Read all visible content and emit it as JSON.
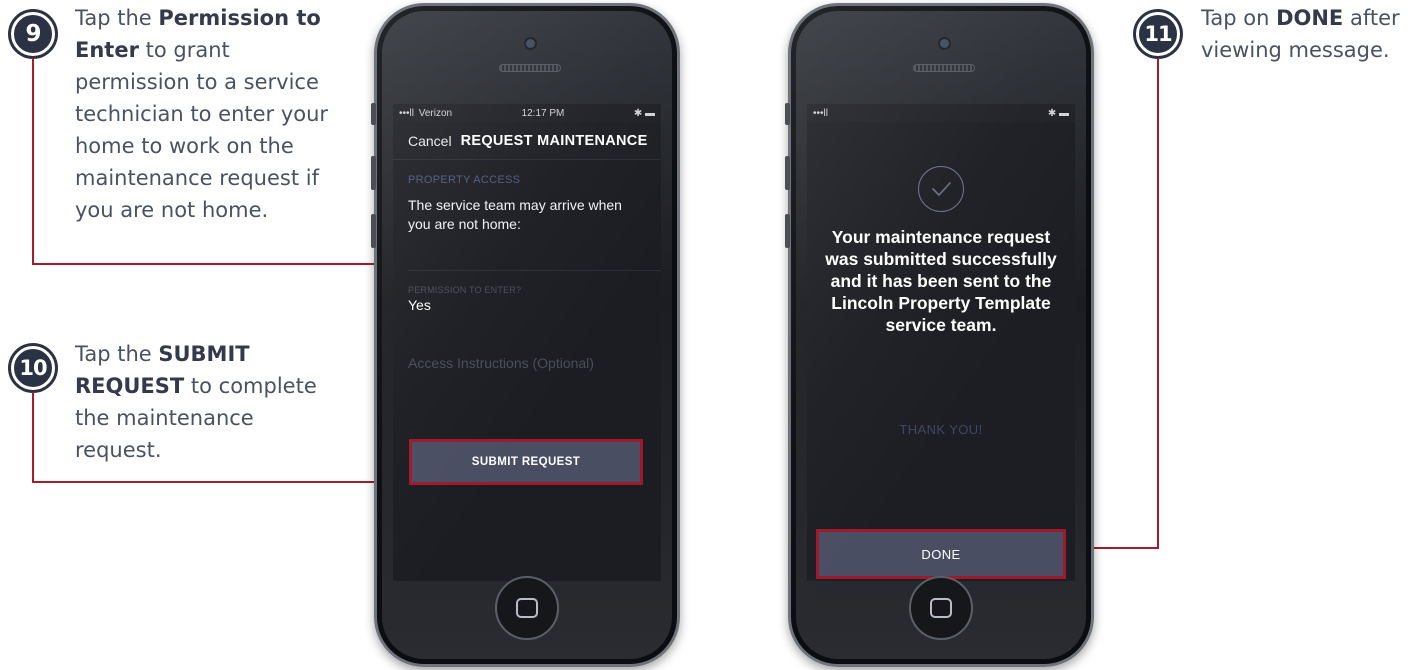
{
  "steps": [
    {
      "number": "9",
      "pre": "Tap the ",
      "bold": "Permission to Enter",
      "post": " to grant permission to a service technician to enter your home to work on the maintenance request if you are not home."
    },
    {
      "number": "10",
      "pre": "Tap the ",
      "bold": "SUBMIT REQUEST",
      "post": " to complete the maintenance request."
    },
    {
      "number": "11",
      "pre": "Tap on ",
      "bold": "DONE",
      "post": " after viewing message."
    }
  ],
  "phone1": {
    "status_carrier": "•••ll  Verizon",
    "status_time": "12:17 PM",
    "status_right": "✱ ▬",
    "nav_cancel": "Cancel",
    "nav_title": "REQUEST MAINTENANCE",
    "section_label": "PROPERTY ACCESS",
    "access_text": "The service team may arrive when you are not home:",
    "permission_label": "PERMISSION TO ENTER?",
    "permission_value": "Yes",
    "instructions_placeholder": "Access Instructions (Optional)",
    "submit_label": "SUBMIT REQUEST"
  },
  "phone2": {
    "status_left": "•••ll",
    "status_right": "✱ ▬",
    "message": "Your maintenance request was submitted successfully and it has been sent to the Lincoln Property Template service team.",
    "thanks": "THANK YOU!",
    "done_label": "DONE"
  },
  "colors": {
    "accent_red": "#a51d2d",
    "badge_navy": "#2b3244",
    "button_slate": "#4a4e63"
  }
}
